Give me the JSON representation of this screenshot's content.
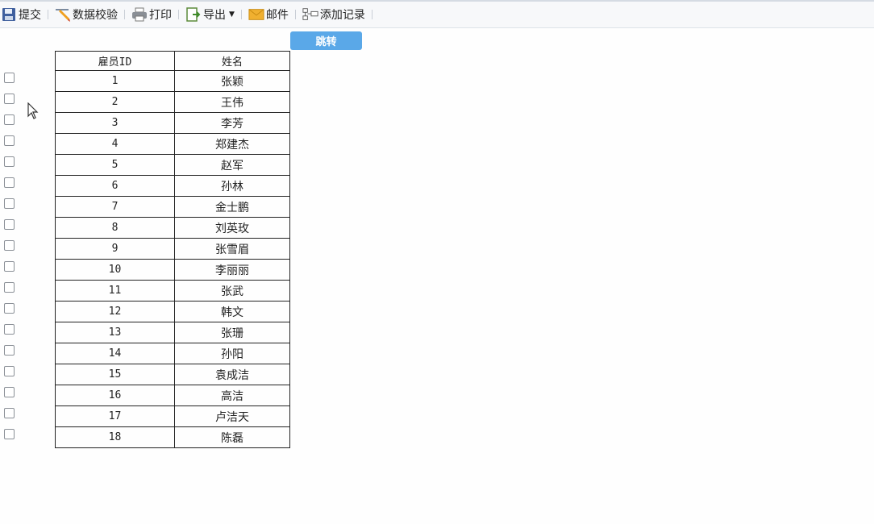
{
  "toolbar": {
    "submit_label": "提交",
    "validate_label": "数据校验",
    "print_label": "打印",
    "export_label": "导出",
    "mail_label": "邮件",
    "add_record_label": "添加记录"
  },
  "jump_button_label": "跳转",
  "table": {
    "headers": [
      "雇员ID",
      "姓名"
    ],
    "rows": [
      [
        "1",
        "张颖"
      ],
      [
        "2",
        "王伟"
      ],
      [
        "3",
        "李芳"
      ],
      [
        "4",
        "郑建杰"
      ],
      [
        "5",
        "赵军"
      ],
      [
        "6",
        "孙林"
      ],
      [
        "7",
        "金士鹏"
      ],
      [
        "8",
        "刘英玫"
      ],
      [
        "9",
        "张雪眉"
      ],
      [
        "10",
        "李丽丽"
      ],
      [
        "11",
        "张武"
      ],
      [
        "12",
        "韩文"
      ],
      [
        "13",
        "张珊"
      ],
      [
        "14",
        "孙阳"
      ],
      [
        "15",
        "袁成洁"
      ],
      [
        "16",
        "高洁"
      ],
      [
        "17",
        "卢洁天"
      ],
      [
        "18",
        "陈磊"
      ]
    ]
  },
  "icons": {
    "submit": "save-icon",
    "validate": "pencil-icon",
    "print": "printer-icon",
    "export": "export-icon",
    "mail": "mail-icon",
    "add_record": "add-record-icon"
  },
  "colors": {
    "jump_button": "#5aa8e8",
    "toolbar_bg": "#f7f8fa"
  }
}
